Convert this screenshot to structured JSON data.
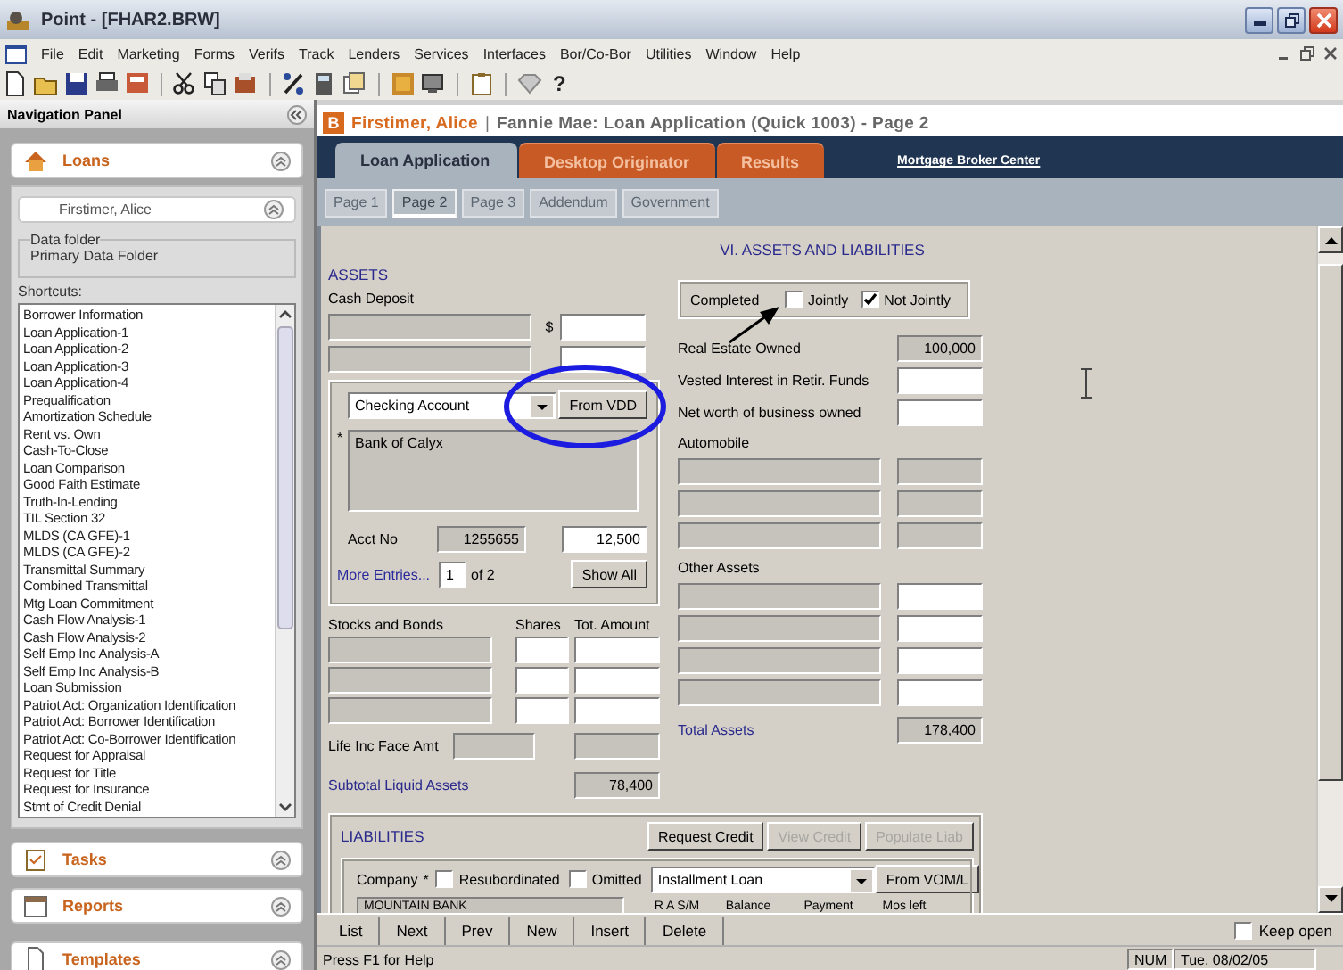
{
  "window": {
    "title": "Point - [FHAR2.BRW]"
  },
  "menu": [
    "File",
    "Edit",
    "Marketing",
    "Forms",
    "Verifs",
    "Track",
    "Lenders",
    "Services",
    "Interfaces",
    "Bor/Co-Bor",
    "Utilities",
    "Window",
    "Help"
  ],
  "toolbar": {
    "help": "?"
  },
  "nav_panel": {
    "title": "Navigation Panel",
    "loans": {
      "label": "Loans",
      "borrower": "Firstimer, Alice",
      "data_folder": {
        "legend": "Data folder",
        "value": "Primary Data Folder"
      },
      "shortcuts_label": "Shortcuts:",
      "shortcuts": [
        "Borrower Information",
        "Loan Application-1",
        "Loan Application-2",
        "Loan Application-3",
        "Loan Application-4",
        "Prequalification",
        "Amortization Schedule",
        "Rent vs. Own",
        "Cash-To-Close",
        "Loan Comparison",
        "Good Faith Estimate",
        "Truth-In-Lending",
        "TIL Section 32",
        "MLDS (CA GFE)-1",
        "MLDS (CA GFE)-2",
        "Transmittal Summary",
        "Combined Transmittal",
        "Mtg Loan Commitment",
        "Cash Flow Analysis-1",
        "Cash Flow Analysis-2",
        "Self Emp Inc Analysis-A",
        "Self Emp Inc Analysis-B",
        "Loan Submission",
        "Patriot Act: Organization Identification",
        "Patriot Act: Borrower Identification",
        "Patriot Act: Co-Borrower Identification",
        "Request for Appraisal",
        "Request for Title",
        "Request for Insurance",
        "Stmt of Credit Denial"
      ]
    },
    "sections": [
      {
        "label": "Tasks",
        "kind": "tasks"
      },
      {
        "label": "Reports",
        "kind": "reports"
      },
      {
        "label": "Templates",
        "kind": "templates"
      }
    ]
  },
  "record": {
    "badge": "B",
    "borrower": "Firstimer, Alice",
    "separator": "|",
    "form_title": "Fannie Mae: Loan Application (Quick 1003) - Page 2"
  },
  "tabs": [
    {
      "label": "Loan Application",
      "selected": true
    },
    {
      "label": "Desktop Originator",
      "selected": false
    },
    {
      "label": "Results",
      "selected": false
    }
  ],
  "link": "Mortgage Broker Center",
  "page_tabs": [
    {
      "label": "Page 1",
      "selected": false
    },
    {
      "label": "Page 2",
      "selected": true
    },
    {
      "label": "Page 3",
      "selected": false
    },
    {
      "label": "Addendum",
      "selected": false
    },
    {
      "label": "Government",
      "selected": false
    }
  ],
  "form": {
    "section_title": "VI. ASSETS AND LIABILITIES",
    "assets": {
      "heading": "ASSETS",
      "cash_deposit_label": "Cash Deposit",
      "currency": "$",
      "account_type": "Checking Account",
      "vdd_button": "From VDD",
      "required_mark": "*",
      "institution": "Bank of Calyx",
      "acct_label": "Acct No",
      "acct_no": "1255655",
      "amount": "12,500",
      "more_link": "More Entries...",
      "entry": "1",
      "entry_total": "of 2",
      "show_all": "Show All",
      "stocks_label": "Stocks and Bonds",
      "shares_label": "Shares",
      "total_label": "Tot. Amount",
      "life_label": "Life Inc Face Amt",
      "subtotal_label": "Subtotal Liquid Assets",
      "subtotal": "78,400"
    },
    "completed": {
      "label": "Completed",
      "options": [
        {
          "label": "Jointly",
          "checked": false
        },
        {
          "label": "Not Jointly",
          "checked": true
        }
      ]
    },
    "real_estate": {
      "label": "Real Estate Owned",
      "value": "100,000"
    },
    "vested_label": "Vested Interest in Retir. Funds",
    "net_worth_label": "Net worth of business owned",
    "automobile_label": "Automobile",
    "other_assets_label": "Other Assets",
    "total_assets": {
      "label": "Total Assets",
      "value": "178,400"
    },
    "liabilities": {
      "heading": "LIABILITIES",
      "buttons": [
        {
          "label": "Request Credit",
          "disabled": false
        },
        {
          "label": "View Credit",
          "disabled": true
        },
        {
          "label": "Populate Liab",
          "disabled": true
        }
      ],
      "company_label": "Company",
      "required_mark": "*",
      "checkboxes": [
        {
          "label": "Resubordinated",
          "checked": false
        },
        {
          "label": "Omitted",
          "checked": false
        }
      ],
      "loan_type": "Installment Loan",
      "vom_button": "From VOM/L",
      "company": "MOUNTAIN BANK",
      "columns": [
        "R A S/M",
        "Balance",
        "Payment",
        "Mos left"
      ]
    }
  },
  "record_buttons": [
    "List",
    "Next",
    "Prev",
    "New",
    "Insert",
    "Delete"
  ],
  "keep_open": {
    "label": "Keep open",
    "checked": false
  },
  "status_bar": {
    "help": "Press F1 for Help",
    "indicator": "NUM",
    "date": "Tue, 08/02/05"
  }
}
